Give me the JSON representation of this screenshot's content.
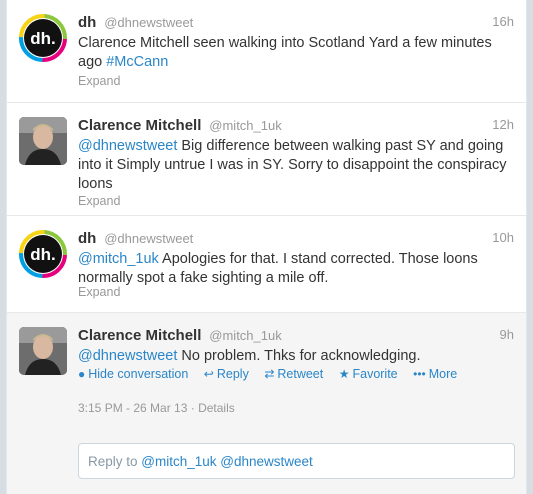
{
  "tweets": [
    {
      "fullname": "dh",
      "username": "@dhnewstweet",
      "time": "16h",
      "text_plain": "Clarence Mitchell seen walking into Scotland Yard a few minutes ago",
      "text_link": "#McCann",
      "expand": "Expand",
      "avatar": "dh-logo"
    },
    {
      "fullname": "Clarence Mitchell",
      "username": "@mitch_1uk",
      "time": "12h",
      "mention": "@dhnewstweet",
      "text_plain": " Big difference between walking past SY and going into it Simply untrue I was in SY. Sorry to disappoint the conspiracy loons",
      "expand": "Expand",
      "avatar": "clarence-photo"
    },
    {
      "fullname": "dh",
      "username": "@dhnewstweet",
      "time": "10h",
      "mention": "@mitch_1uk",
      "text_plain": " Apologies for that. I stand corrected. Those loons normally spot a fake sighting a mile off.",
      "expand": "Expand",
      "avatar": "dh-logo"
    },
    {
      "fullname": "Clarence Mitchell",
      "username": "@mitch_1uk",
      "time": "9h",
      "mention": "@dhnewstweet",
      "text_plain": " No problem. Thks for acknowledging.",
      "avatar": "clarence-photo",
      "actions": {
        "hide": "Hide conversation",
        "reply": "Reply",
        "retweet": "Retweet",
        "favorite": "Favorite",
        "more": "More"
      },
      "timestamp": "3:15 PM - 26 Mar 13",
      "details": "Details",
      "reply_box": {
        "prefix": "Reply to ",
        "mention1": "@mitch_1uk",
        "mention2": "@dhnewstweet"
      }
    }
  ],
  "colors": {
    "link": "#2a86c8",
    "muted": "#999999"
  }
}
